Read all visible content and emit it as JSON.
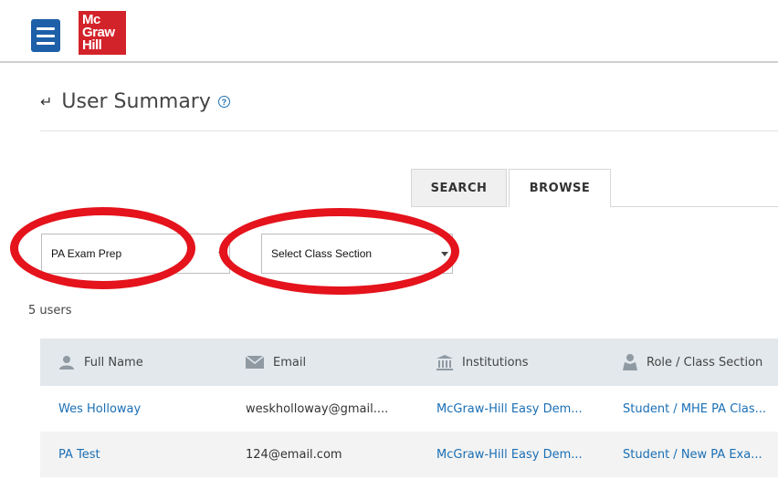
{
  "header": {
    "menu_icon": "hamburger-menu-icon",
    "logo": {
      "line1": "Mc",
      "line2": "Graw",
      "line3": "Hill",
      "color": "#d3232a"
    }
  },
  "page": {
    "title": "User Summary",
    "back_icon": "back-arrow-icon",
    "help_icon": "help-circle-icon"
  },
  "tabs": [
    {
      "label": "SEARCH",
      "active": false
    },
    {
      "label": "BROWSE",
      "active": true
    }
  ],
  "filters": {
    "program": {
      "value": "PA Exam Prep"
    },
    "section": {
      "value": "Select Class Section"
    }
  },
  "user_count": "5 users",
  "table": {
    "columns": [
      {
        "label": "Full Name",
        "icon": "person-icon"
      },
      {
        "label": "Email",
        "icon": "envelope-icon"
      },
      {
        "label": "Institutions",
        "icon": "institution-icon"
      },
      {
        "label": "Role / Class Section",
        "icon": "role-icon"
      }
    ],
    "rows": [
      {
        "name": "Wes Holloway",
        "email": "weskholloway@gmail....",
        "institution": "McGraw-Hill Easy Dem...",
        "role": "Student / MHE PA Clas..."
      },
      {
        "name": "PA Test",
        "email": "124@email.com",
        "institution": "McGraw-Hill Easy Dem...",
        "role": "Student / New PA Exa..."
      }
    ]
  },
  "colors": {
    "accent": "#1a6fb5",
    "highlight": "#e4131c",
    "header_bg": "#e3e8ec"
  }
}
